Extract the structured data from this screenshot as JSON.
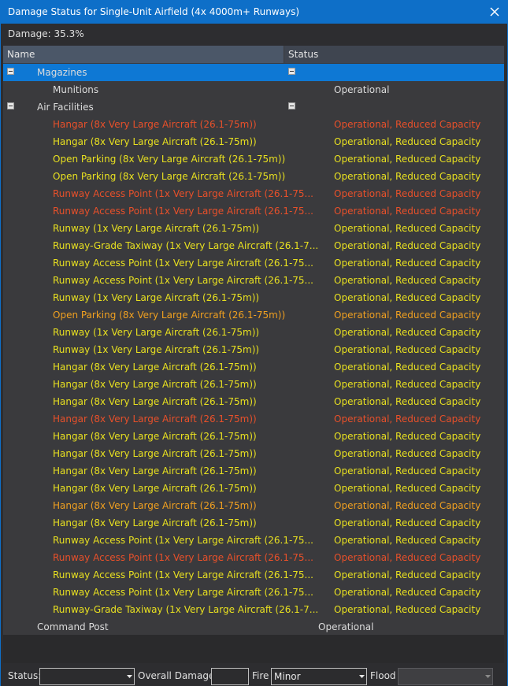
{
  "window": {
    "title": "Damage Status for Single-Unit Airfield (4x 4000m+ Runways)"
  },
  "damage_line": "Damage: 35.3%",
  "columns": {
    "name": "Name",
    "status": "Status"
  },
  "colors": {
    "red": "#e8502a",
    "yellow": "#e8e020",
    "orange": "#f0a020",
    "accent": "#0e6fc8"
  },
  "rows": [
    {
      "name": "Magazines",
      "status": "",
      "level": 1,
      "toggle": true,
      "selected": true,
      "color": "white"
    },
    {
      "name": "Munitions",
      "status": "Operational",
      "level": 2,
      "color": "white"
    },
    {
      "name": "Air Facilities",
      "status": "",
      "level": 1,
      "toggle": true,
      "color": "white"
    },
    {
      "name": "Hangar (8x Very Large Aircraft (26.1-75m))",
      "status": "Operational, Reduced Capacity",
      "level": 2,
      "color": "red"
    },
    {
      "name": "Hangar (8x Very Large Aircraft (26.1-75m))",
      "status": "Operational, Reduced Capacity",
      "level": 2,
      "color": "yellow"
    },
    {
      "name": "Open Parking (8x Very Large Aircraft (26.1-75m))",
      "status": "Operational, Reduced Capacity",
      "level": 2,
      "color": "yellow"
    },
    {
      "name": "Open Parking (8x Very Large Aircraft (26.1-75m))",
      "status": "Operational, Reduced Capacity",
      "level": 2,
      "color": "yellow"
    },
    {
      "name": "Runway Access Point (1x Very Large Aircraft (26.1-75...",
      "status": "Operational, Reduced Capacity",
      "level": 2,
      "color": "red"
    },
    {
      "name": "Runway Access Point (1x Very Large Aircraft (26.1-75...",
      "status": "Operational, Reduced Capacity",
      "level": 2,
      "color": "red"
    },
    {
      "name": "Runway (1x Very Large Aircraft (26.1-75m))",
      "status": "Operational, Reduced Capacity",
      "level": 2,
      "color": "yellow"
    },
    {
      "name": "Runway-Grade Taxiway (1x Very Large Aircraft (26.1-7...",
      "status": "Operational, Reduced Capacity",
      "level": 2,
      "color": "yellow"
    },
    {
      "name": "Runway Access Point (1x Very Large Aircraft (26.1-75...",
      "status": "Operational, Reduced Capacity",
      "level": 2,
      "color": "yellow"
    },
    {
      "name": "Runway Access Point (1x Very Large Aircraft (26.1-75...",
      "status": "Operational, Reduced Capacity",
      "level": 2,
      "color": "yellow"
    },
    {
      "name": "Runway (1x Very Large Aircraft (26.1-75m))",
      "status": "Operational, Reduced Capacity",
      "level": 2,
      "color": "yellow"
    },
    {
      "name": "Open Parking (8x Very Large Aircraft (26.1-75m))",
      "status": "Operational, Reduced Capacity",
      "level": 2,
      "color": "orange"
    },
    {
      "name": "Runway (1x Very Large Aircraft (26.1-75m))",
      "status": "Operational, Reduced Capacity",
      "level": 2,
      "color": "yellow"
    },
    {
      "name": "Runway (1x Very Large Aircraft (26.1-75m))",
      "status": "Operational, Reduced Capacity",
      "level": 2,
      "color": "yellow"
    },
    {
      "name": "Hangar (8x Very Large Aircraft (26.1-75m))",
      "status": "Operational, Reduced Capacity",
      "level": 2,
      "color": "yellow"
    },
    {
      "name": "Hangar (8x Very Large Aircraft (26.1-75m))",
      "status": "Operational, Reduced Capacity",
      "level": 2,
      "color": "yellow"
    },
    {
      "name": "Hangar (8x Very Large Aircraft (26.1-75m))",
      "status": "Operational, Reduced Capacity",
      "level": 2,
      "color": "yellow"
    },
    {
      "name": "Hangar (8x Very Large Aircraft (26.1-75m))",
      "status": "Operational, Reduced Capacity",
      "level": 2,
      "color": "red"
    },
    {
      "name": "Hangar (8x Very Large Aircraft (26.1-75m))",
      "status": "Operational, Reduced Capacity",
      "level": 2,
      "color": "yellow"
    },
    {
      "name": "Hangar (8x Very Large Aircraft (26.1-75m))",
      "status": "Operational, Reduced Capacity",
      "level": 2,
      "color": "yellow"
    },
    {
      "name": "Hangar (8x Very Large Aircraft (26.1-75m))",
      "status": "Operational, Reduced Capacity",
      "level": 2,
      "color": "yellow"
    },
    {
      "name": "Hangar (8x Very Large Aircraft (26.1-75m))",
      "status": "Operational, Reduced Capacity",
      "level": 2,
      "color": "yellow"
    },
    {
      "name": "Hangar (8x Very Large Aircraft (26.1-75m))",
      "status": "Operational, Reduced Capacity",
      "level": 2,
      "color": "orange"
    },
    {
      "name": "Hangar (8x Very Large Aircraft (26.1-75m))",
      "status": "Operational, Reduced Capacity",
      "level": 2,
      "color": "yellow"
    },
    {
      "name": "Runway Access Point (1x Very Large Aircraft (26.1-75...",
      "status": "Operational, Reduced Capacity",
      "level": 2,
      "color": "yellow"
    },
    {
      "name": "Runway Access Point (1x Very Large Aircraft (26.1-75...",
      "status": "Operational, Reduced Capacity",
      "level": 2,
      "color": "red"
    },
    {
      "name": "Runway Access Point (1x Very Large Aircraft (26.1-75...",
      "status": "Operational, Reduced Capacity",
      "level": 2,
      "color": "yellow"
    },
    {
      "name": "Runway Access Point (1x Very Large Aircraft (26.1-75...",
      "status": "Operational, Reduced Capacity",
      "level": 2,
      "color": "yellow"
    },
    {
      "name": "Runway-Grade Taxiway (1x Very Large Aircraft (26.1-7...",
      "status": "Operational, Reduced Capacity",
      "level": 2,
      "color": "yellow"
    },
    {
      "name": "Command Post",
      "status": "Operational",
      "level": 1,
      "color": "white",
      "status_shift": true
    }
  ],
  "footer": {
    "status_label": "Status:",
    "status_value": "",
    "overall_damage_label": "Overall Damage:",
    "overall_damage_value": "",
    "fire_label": "Fire",
    "fire_value": "Minor",
    "flood_label": "Flood",
    "flood_value": ""
  }
}
